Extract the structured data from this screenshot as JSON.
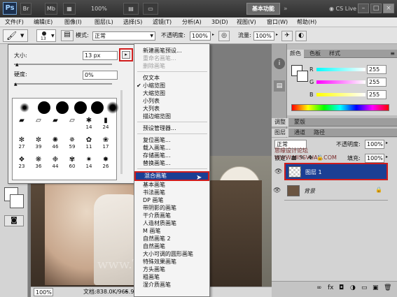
{
  "app": {
    "logo": "Ps",
    "zoom": "100%",
    "workspace": "基本功能",
    "cslive": "CS Live"
  },
  "menubar": [
    "文件(F)",
    "编辑(E)",
    "图像(I)",
    "图层(L)",
    "选择(S)",
    "滤镜(T)",
    "分析(A)",
    "3D(D)",
    "视图(V)",
    "窗口(W)",
    "帮助(H)"
  ],
  "options": {
    "brush_size_badge": "13",
    "mode_label": "模式:",
    "mode_value": "正常",
    "opacity_label": "不透明度:",
    "opacity_value": "100%",
    "flow_label": "流量:",
    "flow_value": "100%"
  },
  "picker": {
    "size_label": "大小:",
    "size_value": "13 px",
    "hardness_label": "硬度:",
    "hardness_value": "0%",
    "cells_row3": [
      "",
      "",
      "",
      "",
      "14",
      "24"
    ],
    "cells_row4": [
      "27",
      "39",
      "46",
      "59",
      "11",
      "17"
    ],
    "cells_row5": [
      "23",
      "36",
      "44",
      "60",
      "14",
      "26"
    ]
  },
  "flyout": {
    "items": [
      {
        "label": "新建画笔预设...",
        "state": "normal"
      },
      {
        "label": "重命名画笔...",
        "state": "disabled"
      },
      {
        "label": "删除画笔",
        "state": "disabled"
      },
      {
        "label": "仅文本",
        "state": "normal"
      },
      {
        "label": "小缩览图",
        "state": "checked"
      },
      {
        "label": "大缩览图",
        "state": "normal"
      },
      {
        "label": "小列表",
        "state": "normal"
      },
      {
        "label": "大列表",
        "state": "normal"
      },
      {
        "label": "描边缩览图",
        "state": "normal"
      },
      {
        "label": "预设管理器...",
        "state": "normal"
      },
      {
        "label": "复位画笔...",
        "state": "normal"
      },
      {
        "label": "载入画笔...",
        "state": "normal"
      },
      {
        "label": "存储画笔...",
        "state": "normal"
      },
      {
        "label": "替换画笔...",
        "state": "normal"
      },
      {
        "label": "混合画笔",
        "state": "selected"
      },
      {
        "label": "基本画笔",
        "state": "normal"
      },
      {
        "label": "书法画笔",
        "state": "normal"
      },
      {
        "label": "DP 画笔",
        "state": "normal"
      },
      {
        "label": "带阴影的画笔",
        "state": "normal"
      },
      {
        "label": "干介质画笔",
        "state": "normal"
      },
      {
        "label": "人造材质画笔",
        "state": "normal"
      },
      {
        "label": "M 画笔",
        "state": "normal"
      },
      {
        "label": "自然画笔 2",
        "state": "normal"
      },
      {
        "label": "自然画笔",
        "state": "normal"
      },
      {
        "label": "大小可调的圆形画笔",
        "state": "normal"
      },
      {
        "label": "特殊效果画笔",
        "state": "normal"
      },
      {
        "label": "方头画笔",
        "state": "normal"
      },
      {
        "label": "粗画笔",
        "state": "normal"
      },
      {
        "label": "湿介质画笔",
        "state": "normal"
      }
    ]
  },
  "color_panel": {
    "tabs": [
      "颜色",
      "色板",
      "样式"
    ],
    "r_label": "R",
    "r_value": "255",
    "g_label": "G",
    "g_value": "255",
    "b_label": "B",
    "b_value": "255"
  },
  "adjust_tabs": [
    "调整",
    "蒙版"
  ],
  "layers_panel": {
    "tabs": [
      "图层",
      "通道",
      "路径"
    ],
    "blend": "正常",
    "opacity_label": "不透明度:",
    "opacity_value": "100%",
    "lock_label": "锁定:",
    "fill_label": "填充:",
    "fill_value": "100%",
    "layers": [
      "图层 1",
      "背景"
    ]
  },
  "watermark_top": "思缘设计论坛 WWW.MISSVUAN.COM",
  "watermark_bottom": "www.TLVI.NET",
  "status": {
    "zoom": "100%",
    "doc": "文档:838.0K/965.9K"
  },
  "colors": {
    "menu_highlight": "#1b3f94",
    "callout_red": "#d01c1c"
  }
}
